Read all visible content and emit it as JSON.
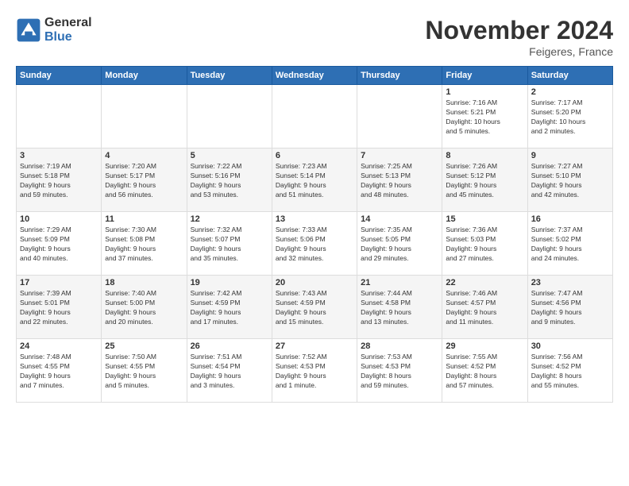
{
  "logo": {
    "general": "General",
    "blue": "Blue"
  },
  "header": {
    "month": "November 2024",
    "location": "Feigeres, France"
  },
  "days_of_week": [
    "Sunday",
    "Monday",
    "Tuesday",
    "Wednesday",
    "Thursday",
    "Friday",
    "Saturday"
  ],
  "weeks": [
    {
      "row_class": "row-1",
      "days": [
        {
          "num": "",
          "info": "",
          "empty": true
        },
        {
          "num": "",
          "info": "",
          "empty": true
        },
        {
          "num": "",
          "info": "",
          "empty": true
        },
        {
          "num": "",
          "info": "",
          "empty": true
        },
        {
          "num": "",
          "info": "",
          "empty": true
        },
        {
          "num": "1",
          "info": "Sunrise: 7:16 AM\nSunset: 5:21 PM\nDaylight: 10 hours\nand 5 minutes."
        },
        {
          "num": "2",
          "info": "Sunrise: 7:17 AM\nSunset: 5:20 PM\nDaylight: 10 hours\nand 2 minutes."
        }
      ]
    },
    {
      "row_class": "row-2",
      "days": [
        {
          "num": "3",
          "info": "Sunrise: 7:19 AM\nSunset: 5:18 PM\nDaylight: 9 hours\nand 59 minutes."
        },
        {
          "num": "4",
          "info": "Sunrise: 7:20 AM\nSunset: 5:17 PM\nDaylight: 9 hours\nand 56 minutes."
        },
        {
          "num": "5",
          "info": "Sunrise: 7:22 AM\nSunset: 5:16 PM\nDaylight: 9 hours\nand 53 minutes."
        },
        {
          "num": "6",
          "info": "Sunrise: 7:23 AM\nSunset: 5:14 PM\nDaylight: 9 hours\nand 51 minutes."
        },
        {
          "num": "7",
          "info": "Sunrise: 7:25 AM\nSunset: 5:13 PM\nDaylight: 9 hours\nand 48 minutes."
        },
        {
          "num": "8",
          "info": "Sunrise: 7:26 AM\nSunset: 5:12 PM\nDaylight: 9 hours\nand 45 minutes."
        },
        {
          "num": "9",
          "info": "Sunrise: 7:27 AM\nSunset: 5:10 PM\nDaylight: 9 hours\nand 42 minutes."
        }
      ]
    },
    {
      "row_class": "row-3",
      "days": [
        {
          "num": "10",
          "info": "Sunrise: 7:29 AM\nSunset: 5:09 PM\nDaylight: 9 hours\nand 40 minutes."
        },
        {
          "num": "11",
          "info": "Sunrise: 7:30 AM\nSunset: 5:08 PM\nDaylight: 9 hours\nand 37 minutes."
        },
        {
          "num": "12",
          "info": "Sunrise: 7:32 AM\nSunset: 5:07 PM\nDaylight: 9 hours\nand 35 minutes."
        },
        {
          "num": "13",
          "info": "Sunrise: 7:33 AM\nSunset: 5:06 PM\nDaylight: 9 hours\nand 32 minutes."
        },
        {
          "num": "14",
          "info": "Sunrise: 7:35 AM\nSunset: 5:05 PM\nDaylight: 9 hours\nand 29 minutes."
        },
        {
          "num": "15",
          "info": "Sunrise: 7:36 AM\nSunset: 5:03 PM\nDaylight: 9 hours\nand 27 minutes."
        },
        {
          "num": "16",
          "info": "Sunrise: 7:37 AM\nSunset: 5:02 PM\nDaylight: 9 hours\nand 24 minutes."
        }
      ]
    },
    {
      "row_class": "row-4",
      "days": [
        {
          "num": "17",
          "info": "Sunrise: 7:39 AM\nSunset: 5:01 PM\nDaylight: 9 hours\nand 22 minutes."
        },
        {
          "num": "18",
          "info": "Sunrise: 7:40 AM\nSunset: 5:00 PM\nDaylight: 9 hours\nand 20 minutes."
        },
        {
          "num": "19",
          "info": "Sunrise: 7:42 AM\nSunset: 4:59 PM\nDaylight: 9 hours\nand 17 minutes."
        },
        {
          "num": "20",
          "info": "Sunrise: 7:43 AM\nSunset: 4:59 PM\nDaylight: 9 hours\nand 15 minutes."
        },
        {
          "num": "21",
          "info": "Sunrise: 7:44 AM\nSunset: 4:58 PM\nDaylight: 9 hours\nand 13 minutes."
        },
        {
          "num": "22",
          "info": "Sunrise: 7:46 AM\nSunset: 4:57 PM\nDaylight: 9 hours\nand 11 minutes."
        },
        {
          "num": "23",
          "info": "Sunrise: 7:47 AM\nSunset: 4:56 PM\nDaylight: 9 hours\nand 9 minutes."
        }
      ]
    },
    {
      "row_class": "row-5",
      "days": [
        {
          "num": "24",
          "info": "Sunrise: 7:48 AM\nSunset: 4:55 PM\nDaylight: 9 hours\nand 7 minutes."
        },
        {
          "num": "25",
          "info": "Sunrise: 7:50 AM\nSunset: 4:55 PM\nDaylight: 9 hours\nand 5 minutes."
        },
        {
          "num": "26",
          "info": "Sunrise: 7:51 AM\nSunset: 4:54 PM\nDaylight: 9 hours\nand 3 minutes."
        },
        {
          "num": "27",
          "info": "Sunrise: 7:52 AM\nSunset: 4:53 PM\nDaylight: 9 hours\nand 1 minute."
        },
        {
          "num": "28",
          "info": "Sunrise: 7:53 AM\nSunset: 4:53 PM\nDaylight: 8 hours\nand 59 minutes."
        },
        {
          "num": "29",
          "info": "Sunrise: 7:55 AM\nSunset: 4:52 PM\nDaylight: 8 hours\nand 57 minutes."
        },
        {
          "num": "30",
          "info": "Sunrise: 7:56 AM\nSunset: 4:52 PM\nDaylight: 8 hours\nand 55 minutes."
        }
      ]
    }
  ]
}
